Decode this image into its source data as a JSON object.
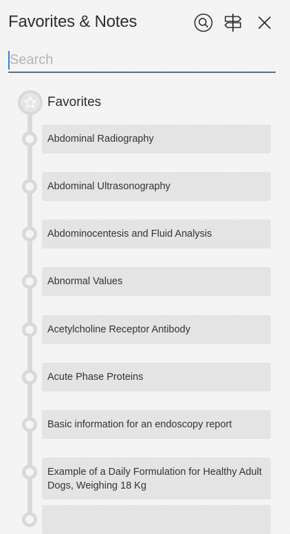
{
  "header": {
    "title": "Favorites & Notes",
    "icons": [
      "search-circle-icon",
      "signpost-icon",
      "close-icon"
    ]
  },
  "search": {
    "placeholder": "Search",
    "value": ""
  },
  "favorites": {
    "label": "Favorites",
    "icon": "star-icon",
    "items": [
      {
        "label": "Abdominal Radiography"
      },
      {
        "label": "Abdominal Ultrasonography"
      },
      {
        "label": "Abdominocentesis and Fluid Analysis"
      },
      {
        "label": "Abnormal Values"
      },
      {
        "label": "Acetylcholine Receptor Antibody"
      },
      {
        "label": "Acute Phase Proteins"
      },
      {
        "label": "Basic information for an endoscopy report"
      },
      {
        "label": "Example of a Daily Formulation for Healthy Adult Dogs, Weighing 18 Kg"
      },
      {
        "label": ""
      }
    ]
  },
  "colors": {
    "timeline": "#d9d9d9",
    "card": "#e4e4e4",
    "search_underline": "#5a6e79",
    "caret": "#3a7bd5"
  }
}
